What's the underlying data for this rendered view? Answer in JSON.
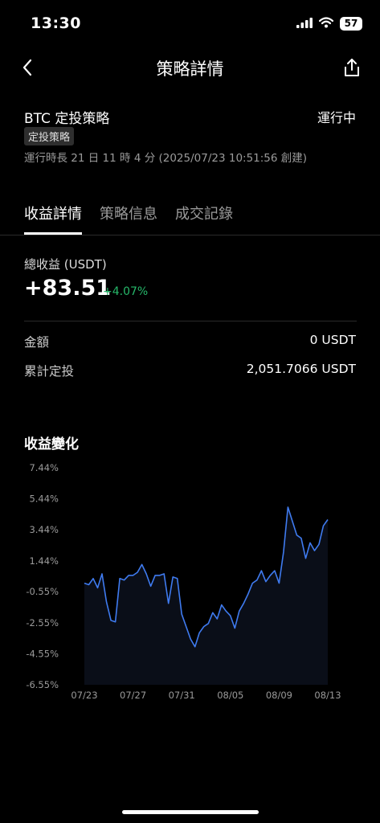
{
  "status_bar": {
    "time": "13:30",
    "battery": "57"
  },
  "nav": {
    "title": "策略詳情"
  },
  "strategy": {
    "name": "BTC 定投策略",
    "status": "運行中",
    "tag": "定投策略",
    "runtime": "運行時長 21 日 11 時 4 分 (2025/07/23 10:51:56 創建)"
  },
  "tabs": [
    {
      "label": "收益詳情",
      "active": true
    },
    {
      "label": "策略信息",
      "active": false
    },
    {
      "label": "成交記錄",
      "active": false
    }
  ],
  "profit": {
    "label": "總收益 (USDT)",
    "value": "+83.51",
    "percent": "+4.07%"
  },
  "rows": [
    {
      "label": "金額",
      "value": "0 USDT"
    },
    {
      "label": "累計定投",
      "value": "2,051.7066 USDT"
    }
  ],
  "chart_title": "收益變化",
  "chart_data": {
    "type": "area",
    "title": "收益變化",
    "y_tick_labels": [
      "7.44%",
      "5.44%",
      "3.44%",
      "1.44%",
      "-0.55%",
      "-2.55%",
      "-4.55%",
      "-6.55%"
    ],
    "y_ticks": [
      7.44,
      5.44,
      3.44,
      1.44,
      -0.55,
      -2.55,
      -4.55,
      -6.55
    ],
    "ylim": [
      -6.55,
      7.44
    ],
    "x_tick_labels": [
      "07/23",
      "07/27",
      "07/31",
      "08/05",
      "08/09",
      "08/13"
    ],
    "xlim": [
      "07/23",
      "08/13"
    ],
    "line_color": "#3f7bf0",
    "grid": false,
    "series": [
      {
        "x": [
          "07/23",
          "07/23",
          "07/24",
          "07/24",
          "07/24",
          "07/25",
          "07/25",
          "07/25",
          "07/26",
          "07/26",
          "07/27",
          "07/27",
          "07/28",
          "07/28",
          "07/28",
          "07/29",
          "07/29",
          "07/30",
          "07/30",
          "07/30",
          "07/31",
          "07/31",
          "07/31",
          "08/01",
          "08/01",
          "08/01",
          "08/02",
          "08/02",
          "08/03",
          "08/03",
          "08/03",
          "08/04",
          "08/04",
          "08/05",
          "08/05",
          "08/05",
          "08/06",
          "08/06",
          "08/07",
          "08/07",
          "08/07",
          "08/08",
          "08/08",
          "08/09",
          "08/09",
          "08/09",
          "08/10",
          "08/10",
          "08/10",
          "08/11",
          "08/11",
          "08/11",
          "08/12",
          "08/12",
          "08/13",
          "08/13"
        ],
        "values": [
          0.0,
          -0.1,
          0.3,
          -0.3,
          0.6,
          -1.2,
          -2.4,
          -2.5,
          0.3,
          0.2,
          0.5,
          0.5,
          0.7,
          1.2,
          0.6,
          -0.2,
          0.5,
          0.5,
          0.6,
          -1.3,
          0.4,
          0.3,
          -2.0,
          -2.8,
          -3.6,
          -4.1,
          -3.2,
          -2.8,
          -2.6,
          -1.9,
          -2.3,
          -1.4,
          -1.8,
          -2.1,
          -2.9,
          -1.8,
          -1.3,
          -0.7,
          0.0,
          0.2,
          0.8,
          0.1,
          0.5,
          0.8,
          0.0,
          2.0,
          4.9,
          4.0,
          3.1,
          2.9,
          1.6,
          2.6,
          2.1,
          2.5,
          3.7,
          4.1
        ]
      }
    ]
  }
}
